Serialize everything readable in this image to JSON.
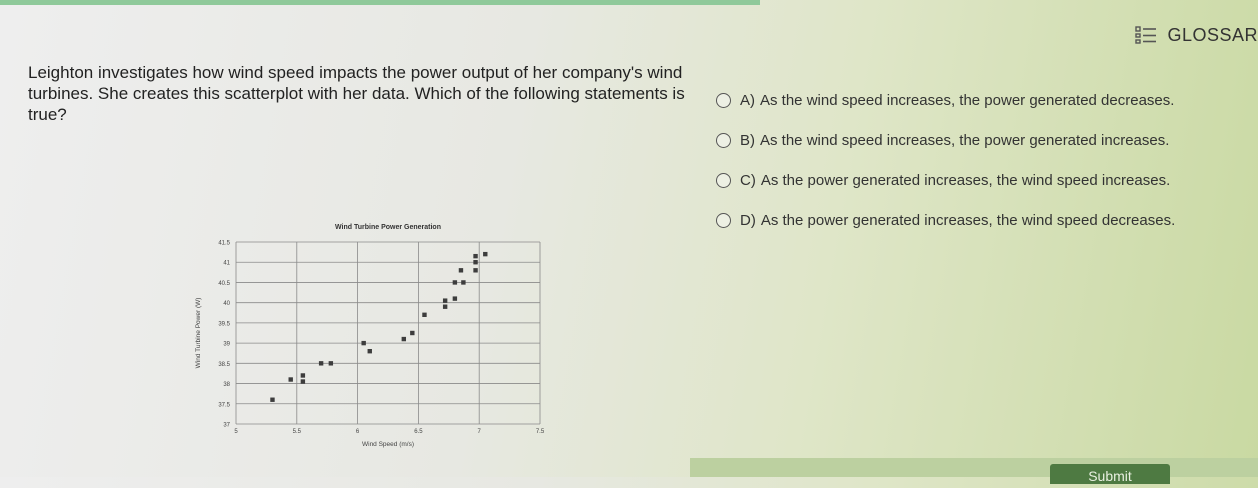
{
  "glossary": {
    "label": "GLOSSAR"
  },
  "question": {
    "text": "Leighton investigates how wind speed impacts the power output of her company's wind turbines. She creates this scatterplot with her data. Which of the following statements is true?"
  },
  "options": [
    {
      "letter": "A)",
      "text": "As the wind speed increases, the power generated decreases."
    },
    {
      "letter": "B)",
      "text": "As the wind speed increases, the power generated increases."
    },
    {
      "letter": "C)",
      "text": "As the power generated increases, the wind speed increases."
    },
    {
      "letter": "D)",
      "text": "As the power generated increases, the wind speed decreases."
    }
  ],
  "submit": {
    "label": "Submit"
  },
  "chart_data": {
    "type": "scatter",
    "title": "Wind Turbine Power Generation",
    "xlabel": "Wind Speed (m/s)",
    "ylabel": "Wind Turbine Power (W)",
    "xlim": [
      5,
      7.5
    ],
    "ylim": [
      37,
      41.5
    ],
    "xticks": [
      "5",
      "5.5",
      "6",
      "6.5",
      "7",
      "7.5"
    ],
    "yticks": [
      "37",
      "37.5",
      "38",
      "38.5",
      "39",
      "39.5",
      "40",
      "40.5",
      "41",
      "41.5"
    ],
    "grid": true,
    "points": [
      {
        "x": 5.3,
        "y": 37.6
      },
      {
        "x": 5.45,
        "y": 38.1
      },
      {
        "x": 5.55,
        "y": 38.2
      },
      {
        "x": 5.55,
        "y": 38.05
      },
      {
        "x": 5.7,
        "y": 38.5
      },
      {
        "x": 5.78,
        "y": 38.5
      },
      {
        "x": 6.05,
        "y": 39.0
      },
      {
        "x": 6.1,
        "y": 38.8
      },
      {
        "x": 6.38,
        "y": 39.1
      },
      {
        "x": 6.45,
        "y": 39.25
      },
      {
        "x": 6.55,
        "y": 39.7
      },
      {
        "x": 6.72,
        "y": 39.9
      },
      {
        "x": 6.72,
        "y": 40.05
      },
      {
        "x": 6.8,
        "y": 40.1
      },
      {
        "x": 6.8,
        "y": 40.5
      },
      {
        "x": 6.87,
        "y": 40.5
      },
      {
        "x": 6.85,
        "y": 40.8
      },
      {
        "x": 6.97,
        "y": 40.8
      },
      {
        "x": 6.97,
        "y": 41.0
      },
      {
        "x": 7.05,
        "y": 41.2
      },
      {
        "x": 6.97,
        "y": 41.15
      }
    ]
  }
}
